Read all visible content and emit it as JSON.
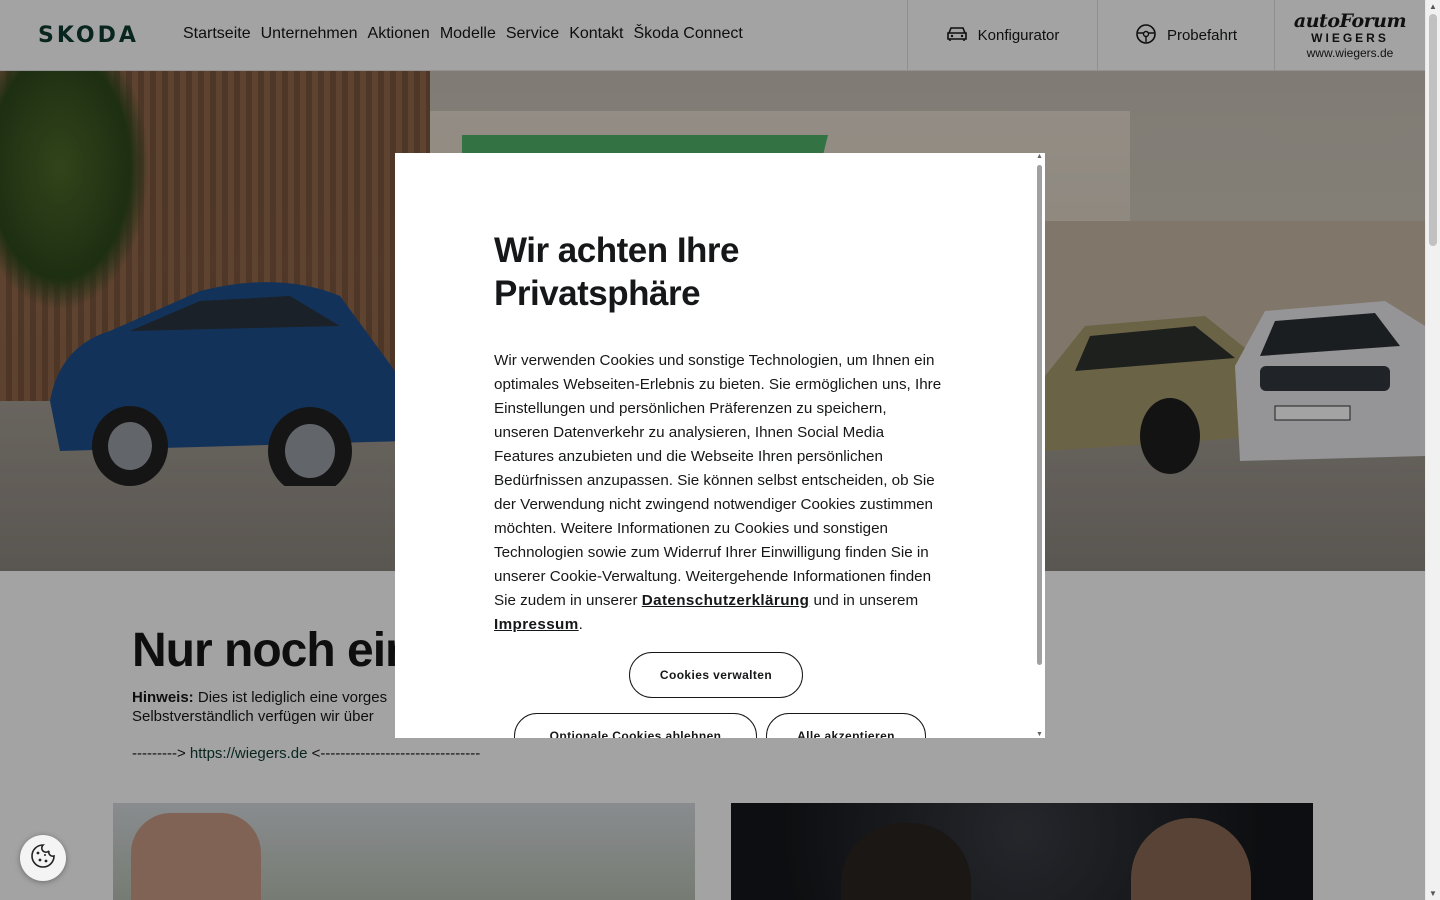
{
  "header": {
    "brand": "SKODA",
    "nav": [
      "Startseite",
      "Unternehmen",
      "Aktionen",
      "Modelle",
      "Service",
      "Kontakt",
      "Škoda Connect"
    ],
    "konfigurator_label": "Konfigurator",
    "probefahrt_label": "Probefahrt",
    "dealer": {
      "line1": "autoForum",
      "line2": "WIEGERS",
      "line3": "www.wiegers.de"
    }
  },
  "hero": {
    "icon": "car-photo",
    "colors": {
      "promo": "#4fb36a"
    }
  },
  "content": {
    "heading": "Nur noch ein",
    "hint_label": "Hinweis:",
    "hint_text": "Dies ist lediglich eine vorges",
    "hint_text2": "Selbstverständlich verfügen wir über",
    "link_prefix": "---------> ",
    "link_url": "https://wiegers.de",
    "link_suffix": " <--------------------------------"
  },
  "modal": {
    "title": "Wir achten Ihre Privatsphäre",
    "body": "Wir verwenden Cookies und sonstige Technologien, um Ihnen ein optimales Webseiten-Erlebnis zu bieten. Sie ermöglichen uns, Ihre Einstellungen und persönlichen Präferenzen zu speichern, unseren Datenverkehr zu analysieren, Ihnen Social Media Features anzubieten und die Webseite Ihren persönlichen Bedürfnissen anzupassen. Sie können selbst entscheiden, ob Sie der Verwendung nicht zwingend notwendiger Cookies zustimmen möchten. Weitere Informationen zu Cookies und sonstigen Technologien sowie zum Widerruf Ihrer Einwilligung finden Sie in unserer Cookie-Verwaltung. Weitergehende Informationen finden Sie zudem in unserer ",
    "link_privacy": "Datenschutzerklärung",
    "between": " und in unserem ",
    "link_imprint": "Impressum",
    "end": ".",
    "btn_manage": "Cookies verwalten",
    "btn_reject": "Optionale Cookies ablehnen",
    "btn_accept": "Alle akzeptieren"
  },
  "icons": {
    "konfigurator": "car-icon",
    "probefahrt": "steering-wheel-icon",
    "cookie": "cookie-icon"
  },
  "colors": {
    "brand_green": "#0e3a2f",
    "overlay": "rgba(0,0,0,0.36)"
  }
}
